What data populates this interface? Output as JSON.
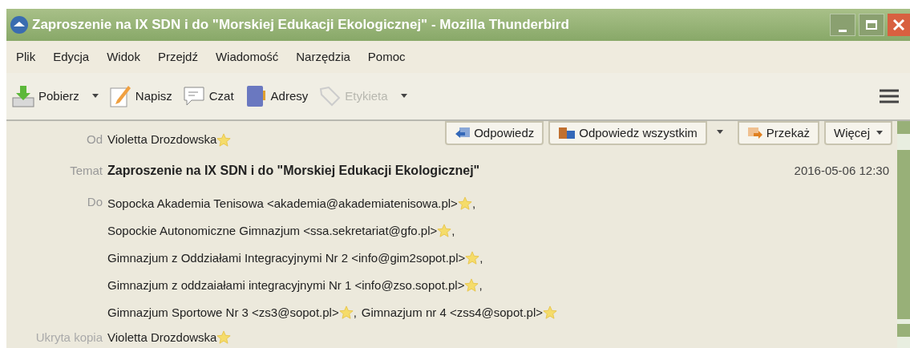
{
  "window": {
    "title": "Zaproszenie na IX SDN i do \"Morskiej Edukacji Ekologicznej\" - Mozilla Thunderbird"
  },
  "menu": [
    "Plik",
    "Edycja",
    "Widok",
    "Przejdź",
    "Wiadomość",
    "Narzędzia",
    "Pomoc"
  ],
  "toolbar": [
    {
      "kind": "download",
      "label": "Pobierz",
      "dropdown": true,
      "disabled": false
    },
    {
      "kind": "write",
      "label": "Napisz",
      "dropdown": false,
      "disabled": false
    },
    {
      "kind": "chat",
      "label": "Czat",
      "dropdown": false,
      "disabled": false
    },
    {
      "kind": "book",
      "label": "Adresy",
      "dropdown": false,
      "disabled": false
    },
    {
      "kind": "tag",
      "label": "Etykieta",
      "dropdown": true,
      "disabled": true
    }
  ],
  "header": {
    "from": {
      "label": "Od",
      "name": "Violetta Drozdowska"
    },
    "actions": [
      {
        "kind": "reply",
        "label": "Odpowiedz"
      },
      {
        "kind": "reply-all",
        "label": "Odpowiedz wszystkim"
      },
      {
        "kind": "dropdown"
      },
      {
        "kind": "forward",
        "label": "Przekaż"
      },
      {
        "kind": "more",
        "label": "Więcej"
      }
    ],
    "subject": {
      "label": "Temat",
      "text": "Zaproszenie na IX SDN i do \"Morskiej Edukacji Ekologicznej\""
    },
    "date": "2016-05-06 12:30",
    "to": {
      "label": "Do",
      "lines": [
        [
          {
            "text": "Sopocka Akademia Tenisowa <akademia@akademiatenisowa.pl>",
            "separator": ","
          }
        ],
        [
          {
            "text": "Sopockie Autonomiczne Gimnazjum <ssa.sekretariat@gfo.pl>",
            "separator": ","
          }
        ],
        [
          {
            "text": "Gimnazjum z Oddziałami Integracyjnymi Nr 2 <info@gim2sopot.pl>",
            "separator": ","
          }
        ],
        [
          {
            "text": "Gimnazjum z oddzaiałami integracyjnymi Nr 1 <info@zso.sopot.pl>",
            "separator": ","
          }
        ],
        [
          {
            "text": "Gimnazjum Sportowe Nr 3 <zs3@sopot.pl>",
            "separator": ","
          },
          {
            "text": "Gimnazjum nr 4 <zss4@sopot.pl>"
          }
        ]
      ]
    },
    "bcc": {
      "label": "Ukryta kopia",
      "name": "Violetta Drozdowska"
    }
  }
}
